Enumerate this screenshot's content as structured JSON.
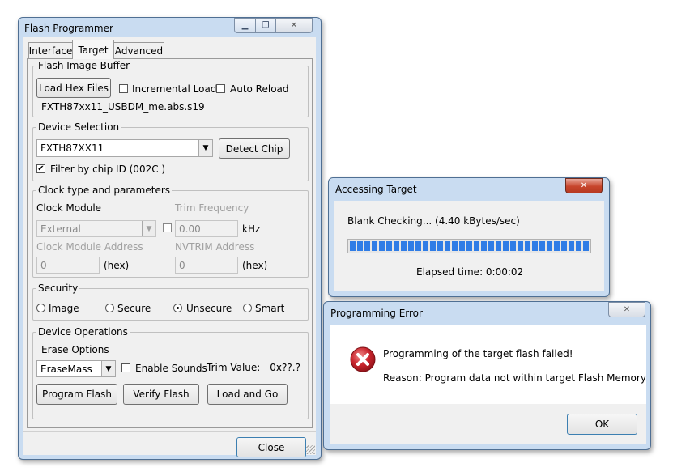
{
  "flash_programmer": {
    "title": "Flash Programmer",
    "tabs": [
      "Interface",
      "Target",
      "Advanced"
    ],
    "active_tab": "Target",
    "image_buffer": {
      "label": "Flash Image Buffer",
      "load_button": "Load Hex Files",
      "incremental_load": {
        "label": "Incremental Load",
        "checked": false
      },
      "auto_reload": {
        "label": "Auto Reload",
        "checked": false
      },
      "file_name": "FXTH87xx11_USBDM_me.abs.s19"
    },
    "device_selection": {
      "label": "Device Selection",
      "device": "FXTH87XX11",
      "detect_button": "Detect Chip",
      "filter": {
        "label": "Filter by chip ID (002C )",
        "checked": true
      }
    },
    "clock": {
      "label": "Clock type and parameters",
      "module_label": "Clock Module",
      "module_value": "External",
      "trim_label": "Trim Frequency",
      "trim_value": "0.00",
      "trim_unit": "kHz",
      "address_label": "Clock Module Address",
      "address_value": "0",
      "address_unit": "(hex)",
      "nvtrim_label": "NVTRIM Address",
      "nvtrim_value": "0",
      "nvtrim_unit": "(hex)"
    },
    "security": {
      "label": "Security",
      "options": [
        "Image",
        "Secure",
        "Unsecure",
        "Smart"
      ],
      "selected": "Unsecure"
    },
    "operations": {
      "label": "Device Operations",
      "erase_label": "Erase Options",
      "erase_value": "EraseMass",
      "sounds": {
        "label": "Enable Sounds",
        "checked": false
      },
      "trim_value_text": "Trim Value: - 0x??.?",
      "program_button": "Program Flash",
      "verify_button": "Verify Flash",
      "load_go_button": "Load and Go"
    },
    "close_button": "Close"
  },
  "accessing_target": {
    "title": "Accessing Target",
    "status": "Blank Checking... (4.40 kBytes/sec)",
    "progress": 1.0,
    "elapsed": "Elapsed time:   0:00:02"
  },
  "programming_error": {
    "title": "Programming Error",
    "message": "Programming of the target flash failed!",
    "reason": "Reason: Program data not within target Flash Memory",
    "ok_button": "OK"
  },
  "colors": {
    "frame": "#c9dcf1",
    "face": "#f0f0f0",
    "progress": "#2f7ce6",
    "close_red": "#c7452c",
    "error_icon": "#c8232c"
  },
  "icons": {
    "minimize": "minimize-icon",
    "maximize": "maximize-icon",
    "close": "close-icon",
    "error": "error-icon"
  }
}
